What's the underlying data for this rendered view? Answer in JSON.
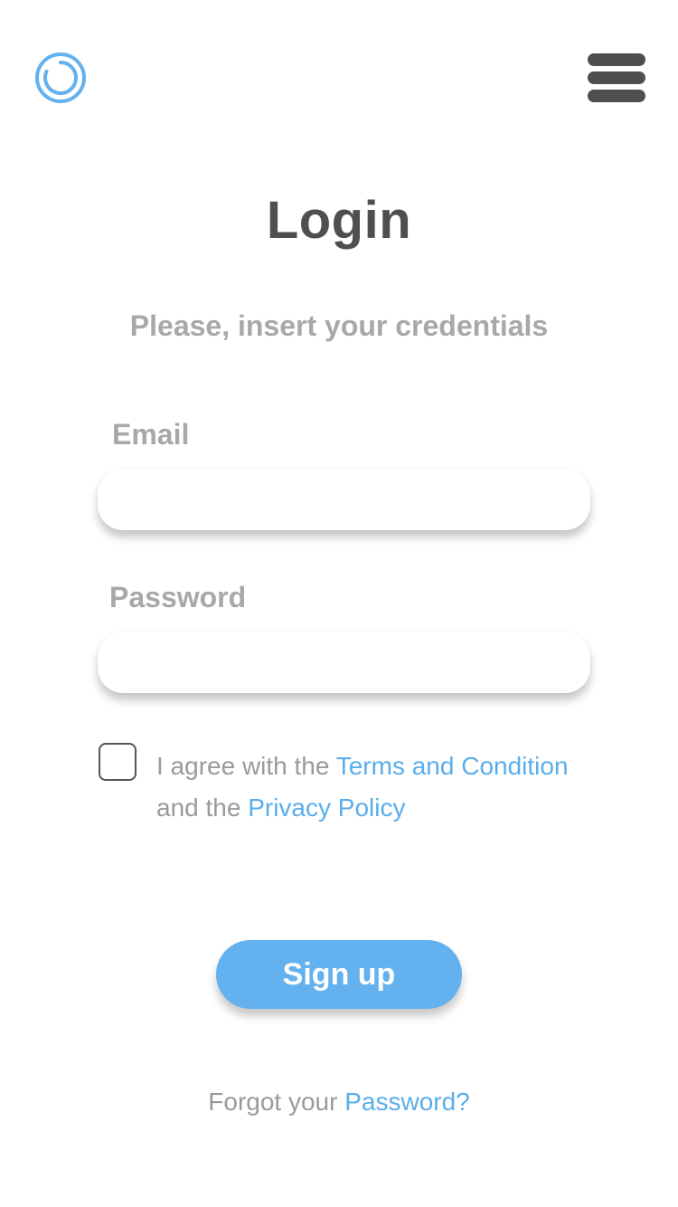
{
  "header": {
    "logo_icon": "ring-logo-icon",
    "menu_icon": "hamburger-menu-icon"
  },
  "title": "Login",
  "subtitle": "Please, insert your credentials",
  "form": {
    "email_label": "Email",
    "email_value": "",
    "email_placeholder": "",
    "password_label": "Password",
    "password_value": "",
    "password_placeholder": "",
    "agreement": {
      "checked": false,
      "text_prefix": "I agree with the ",
      "terms_link": "Terms and Condition",
      "text_middle": " and the ",
      "privacy_link": "Privacy Policy"
    },
    "submit_label": "Sign up"
  },
  "forgot": {
    "prefix": "Forgot your ",
    "link": "Password?"
  },
  "colors": {
    "accent": "#63b1ee",
    "link": "#5aaeea",
    "heading": "#4f4f4f",
    "muted": "#a8a8a8"
  }
}
